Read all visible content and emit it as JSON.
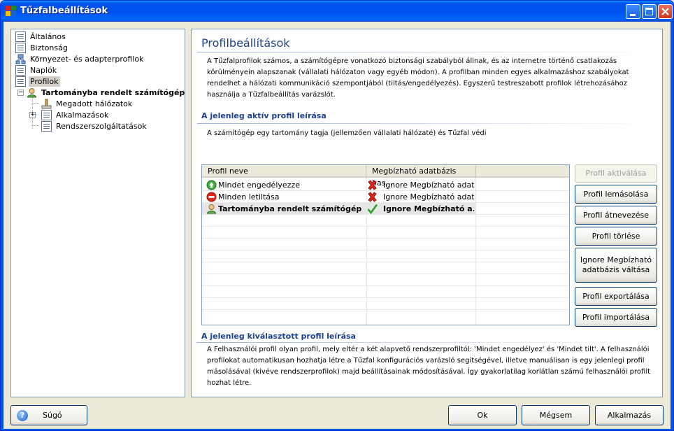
{
  "window": {
    "title": "Tűzfalbeállítások"
  },
  "tree": {
    "items": [
      {
        "label": "Általános"
      },
      {
        "label": "Biztonság"
      },
      {
        "label": "Környezet- és adapterprofilok"
      },
      {
        "label": "Naplók"
      },
      {
        "label": "Profilok"
      },
      {
        "label": "Tartományba rendelt számítógép"
      },
      {
        "label": "Megadott hálózatok"
      },
      {
        "label": "Alkalmazások"
      },
      {
        "label": "Rendszerszolgáltatások"
      }
    ]
  },
  "main": {
    "title": "Profilbeállítások",
    "intro": "A Tűzfalprofilok számos, a számítógépre vonatkozó biztonsági szabályból állnak, és az internetre történő csatlakozás körülményein alapszanak (vállalati hálózaton vagy egyéb módon). A profilban minden egyes alkalmazáshoz szabályokat rendelhet a hálózati kommunikáció szempontjából (tiltás/engedélyezés). Egyszerű testreszabott profilok létrehozásához használja a Tűzfalbeállítás varázslót.",
    "active_section": {
      "title": "A jelenleg aktív profil leírása",
      "text": "A számítógép egy tartomány tagja (jellemzően vállalati hálózaté) és Tűzfal védi"
    },
    "selected_section": {
      "title": "A jelenleg kiválasztott profil leírása",
      "text": "A Felhasználói profil olyan profil, mely eltér a két alapvető rendszerprofiltól: 'Mindet engedélyez' és 'Mindet tilt'. A felhasználói profilokat automatikusan hozhatja létre a Tűzfal konfigurációs varázsló segítségével, illetve manuálisan is egy jelenlegi profil másolásával (kivéve rendszerprofilok) majd beállításainak módosításával. Így gyakorlatilag korlátlan számú felhasználói profilt hozhat létre."
    },
    "profile_table": {
      "columns": [
        "Profil neve",
        "Megbízható adatbázis  has..."
      ],
      "rows": [
        {
          "name": "Mindet engedélyezze",
          "db": "Ignore Megbízható adat...",
          "icon": "allow-all-icon",
          "status_icon": "red-x-icon"
        },
        {
          "name": "Minden letiltása",
          "db": "Ignore Megbízható adat...",
          "icon": "block-all-icon",
          "status_icon": "red-x-icon"
        },
        {
          "name": "Tartományba rendelt számítógép",
          "db": "Ignore Megbízható a...",
          "icon": "user-profile-icon",
          "status_icon": "green-check-icon"
        }
      ]
    },
    "buttons": {
      "activate": "Profil aktiválása",
      "copy": "Profil lemásolása",
      "rename": "Profil átnevezése",
      "delete": "Profil törlése",
      "toggle_db": "Ignore Megbízható adatbázis  váltása",
      "export": "Profil exportálása",
      "import": "Profil importálása"
    }
  },
  "footer": {
    "help": "Súgó",
    "ok": "Ok",
    "cancel": "Mégsem",
    "apply": "Alkalmazás"
  },
  "colors": {
    "title_bar": "#0054e3",
    "section_title": "#1c3f8c"
  }
}
